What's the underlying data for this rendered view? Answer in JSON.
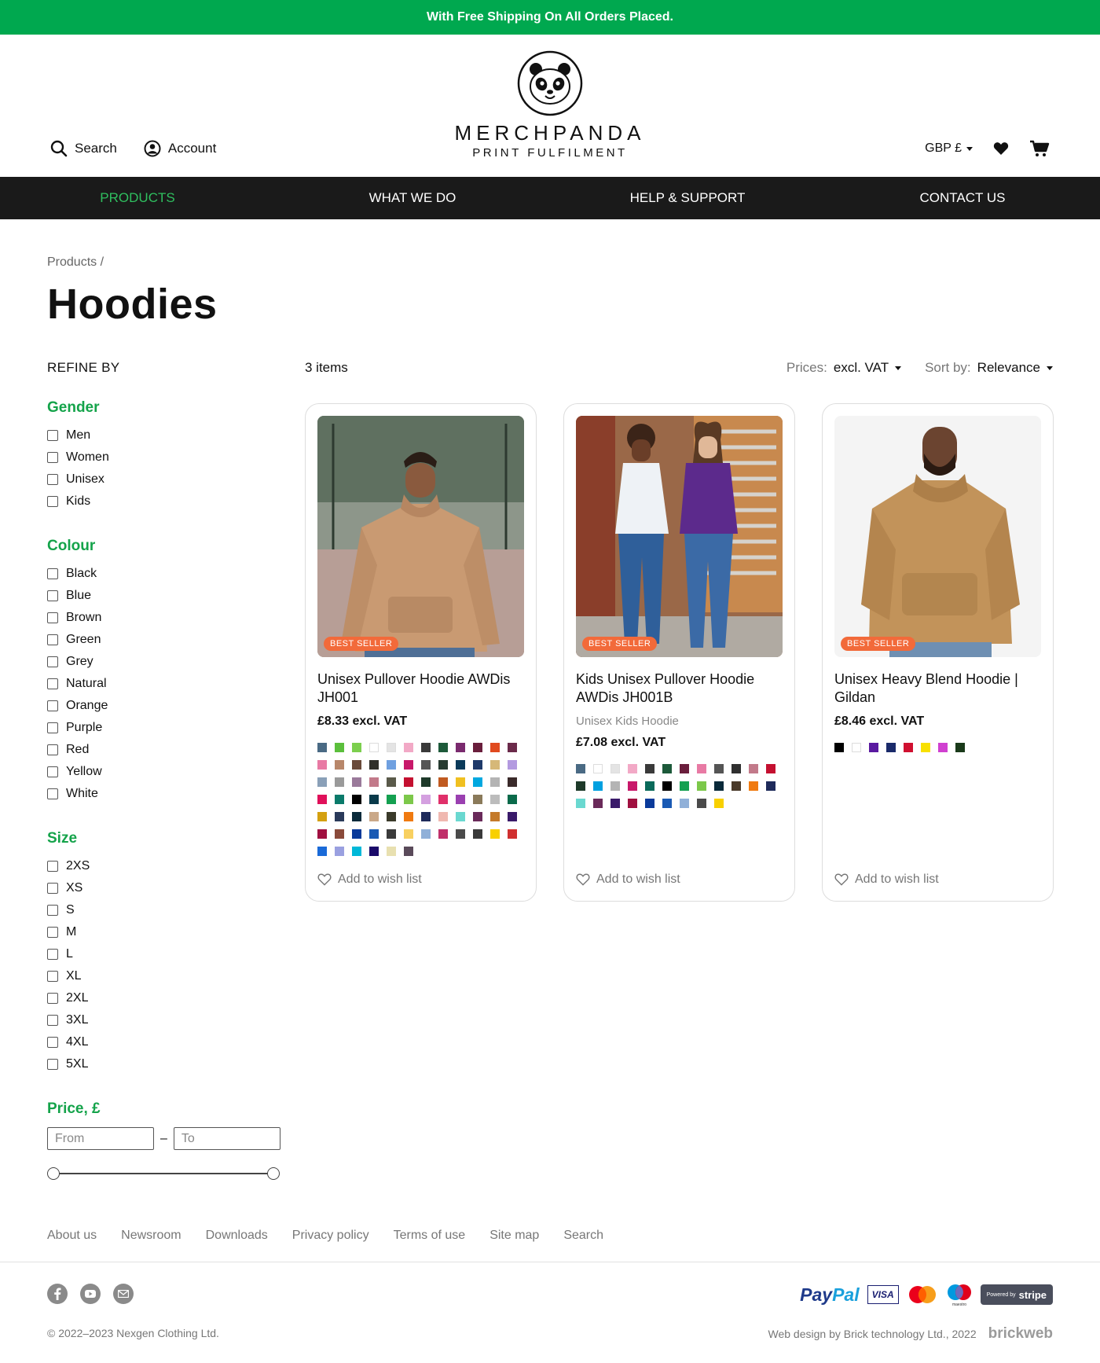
{
  "promo": {
    "text": "With Free Shipping On All Orders Placed."
  },
  "header": {
    "search_label": "Search",
    "account_label": "Account",
    "logo_title": "MERCHPANDA",
    "logo_subtitle": "PRINT FULFILMENT",
    "currency": "GBP £",
    "wishlist_icon": "heart-icon",
    "cart_icon": "cart-icon"
  },
  "nav": {
    "items": [
      {
        "label": "PRODUCTS",
        "active": true
      },
      {
        "label": "WHAT WE DO"
      },
      {
        "label": "HELP & SUPPORT"
      },
      {
        "label": "CONTACT US"
      }
    ]
  },
  "breadcrumb": {
    "items": [
      "Products"
    ],
    "separator": "/"
  },
  "page": {
    "title": "Hoodies"
  },
  "filters": {
    "heading": "REFINE BY",
    "gender": {
      "title": "Gender",
      "options": [
        "Men",
        "Women",
        "Unisex",
        "Kids"
      ]
    },
    "colour": {
      "title": "Colour",
      "options": [
        "Black",
        "Blue",
        "Brown",
        "Green",
        "Grey",
        "Natural",
        "Orange",
        "Purple",
        "Red",
        "Yellow",
        "White"
      ]
    },
    "size": {
      "title": "Size",
      "options": [
        "2XS",
        "XS",
        "S",
        "M",
        "L",
        "XL",
        "2XL",
        "3XL",
        "4XL",
        "5XL"
      ]
    },
    "price": {
      "title": "Price, £",
      "from_placeholder": "From",
      "to_placeholder": "To",
      "separator": "–"
    }
  },
  "results": {
    "count": "3 items",
    "prices_label": "Prices:",
    "prices_value": "excl. VAT",
    "sort_label": "Sort by:",
    "sort_value": "Relevance"
  },
  "products": [
    {
      "name": "Unisex Pullover Hoodie AWDis JH001",
      "subtitle": "",
      "price": "£8.33 excl. VAT",
      "badge": "BEST SELLER",
      "wishlist": "Add to wish list",
      "swatches": [
        "#4a6a84",
        "#5bbf3c",
        "#7ccf4e",
        "#ffffff",
        "#e4e4e4",
        "#f2a9c6",
        "#3a3a3a",
        "#1d5a3a",
        "#7a2a6e",
        "#6a1e3c",
        "#e04a1f",
        "#6b2a4a",
        "#e87aa4",
        "#b8876a",
        "#6a4a3a",
        "#2f2f2a",
        "#6fa0e0",
        "#c8186a",
        "#555555",
        "#263a30",
        "#0a3a5a",
        "#1e3a6a",
        "#d6b878",
        "#b39ae0",
        "#8aa0b8",
        "#9a9a9a",
        "#9a7a9a",
        "#c27a8a",
        "#5a5a4a",
        "#c41030",
        "#1e3a2a",
        "#c05a20",
        "#f0c020",
        "#00a8e0",
        "#b4b4b4",
        "#3a2a2a",
        "#e0105a",
        "#0a7a6a",
        "#000000",
        "#0a3a4a",
        "#14a050",
        "#7cc84a",
        "#d4a0e0",
        "#e0306a",
        "#9a40b0",
        "#8a7a5a",
        "#bcbcbc",
        "#0a6a4a",
        "#d4a010",
        "#2a3a5a",
        "#0a2a3a",
        "#caa888",
        "#3a3a2a",
        "#f07a10",
        "#1e2a5a",
        "#f0b8b0",
        "#6ad8d0",
        "#6a2a5a",
        "#c47a2a",
        "#3a1a6a",
        "#a01040",
        "#8a4a3a",
        "#0a3a9a",
        "#1a5ab4",
        "#3a3a3a",
        "#f8d060",
        "#90b0d8",
        "#c0306a",
        "#4a4a4a",
        "#3a3a3a",
        "#f8d000",
        "#d03030",
        "#1a6ad8",
        "#9aa0e0",
        "#00b8d8",
        "#1a0a6a",
        "#e8e0b0",
        "#5a4a5a"
      ]
    },
    {
      "name": "Kids Unisex Pullover Hoodie AWDis JH001B",
      "subtitle": "Unisex Kids Hoodie",
      "price": "£7.08 excl. VAT",
      "badge": "BEST SELLER",
      "wishlist": "Add to wish list",
      "swatches": [
        "#4a6a84",
        "#ffffff",
        "#e4e4e4",
        "#f2a9c6",
        "#3a3a3a",
        "#1d5a3a",
        "#6a1e3c",
        "#e87aa4",
        "#555555",
        "#2f2f2f",
        "#c27a8a",
        "#c41030",
        "#1e3a2a",
        "#00a0e0",
        "#b4b4b4",
        "#c8186a",
        "#0a6a5a",
        "#000000",
        "#14a050",
        "#7cc84a",
        "#0a2a3a",
        "#4a3a2a",
        "#f07a10",
        "#1e2a5a",
        "#6ad8d0",
        "#6a2a5a",
        "#3a1a6a",
        "#a01040",
        "#0a3a9a",
        "#1a5ab4",
        "#90b0d8",
        "#4a4a4a",
        "#f8d000"
      ]
    },
    {
      "name": "Unisex Heavy Blend Hoodie | Gildan",
      "subtitle": "",
      "price": "£8.46 excl. VAT",
      "badge": "BEST SELLER",
      "wishlist": "Add to wish list",
      "swatches": [
        "#000000",
        "#ffffff",
        "#5a1aa0",
        "#1a2a6a",
        "#d01030",
        "#f8e000",
        "#d040d0",
        "#1a3a1a"
      ]
    }
  ],
  "footer": {
    "links": [
      "About us",
      "Newsroom",
      "Downloads",
      "Privacy policy",
      "Terms of use",
      "Site map",
      "Search"
    ],
    "social": [
      "facebook-icon",
      "youtube-icon",
      "email-icon"
    ],
    "payments": {
      "paypal_a": "Pay",
      "paypal_b": "Pal",
      "visa": "VISA",
      "maestro": "maestro",
      "stripe_powered": "Powered by",
      "stripe": "stripe"
    },
    "copyright": "© 2022–2023 Nexgen Clothing Ltd.",
    "credit": "Web design by Brick technology Ltd., 2022",
    "brand": "brickweb"
  },
  "colors": {
    "accent_green": "#00a84f",
    "nav_bg": "#1a1a1a",
    "badge": "#f26a3a"
  }
}
